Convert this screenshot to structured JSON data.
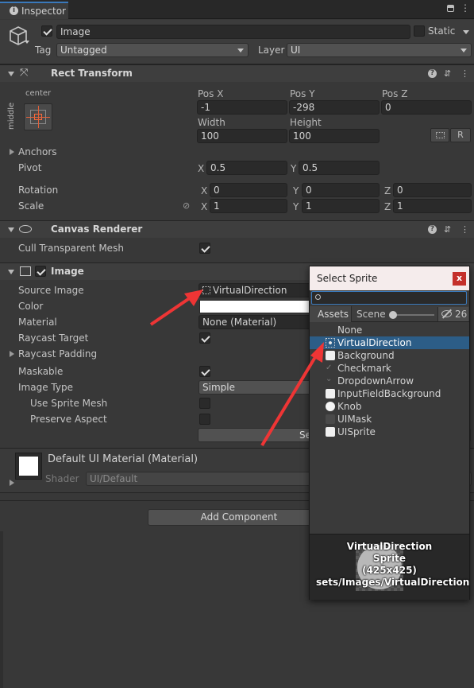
{
  "tab": {
    "title": "Inspector"
  },
  "object": {
    "name": "Image",
    "static_label": "Static",
    "tag_label": "Tag",
    "tag_value": "Untagged",
    "layer_label": "Layer",
    "layer_value": "UI"
  },
  "rect_transform": {
    "title": "Rect Transform",
    "anchor_h": "center",
    "anchor_v": "middle",
    "pos_x_label": "Pos X",
    "pos_x": "-1",
    "pos_y_label": "Pos Y",
    "pos_y": "-298",
    "pos_z_label": "Pos Z",
    "pos_z": "0",
    "width_label": "Width",
    "width": "100",
    "height_label": "Height",
    "height": "100",
    "r_button": "R",
    "anchors_label": "Anchors",
    "pivot_label": "Pivot",
    "pivot_x_label": "X",
    "pivot_x": "0.5",
    "pivot_y_label": "Y",
    "pivot_y": "0.5",
    "rotation_label": "Rotation",
    "rot_x_label": "X",
    "rot_x": "0",
    "rot_y_label": "Y",
    "rot_y": "0",
    "rot_z_label": "Z",
    "rot_z": "0",
    "scale_label": "Scale",
    "scale_x_label": "X",
    "scale_x": "1",
    "scale_y_label": "Y",
    "scale_y": "1",
    "scale_z_label": "Z",
    "scale_z": "1"
  },
  "canvas_renderer": {
    "title": "Canvas Renderer",
    "cull_label": "Cull Transparent Mesh",
    "cull_checked": true
  },
  "image_component": {
    "title": "Image",
    "source_image_label": "Source Image",
    "source_image_value": "VirtualDirection",
    "color_label": "Color",
    "material_label": "Material",
    "material_value": "None (Material)",
    "raycast_target_label": "Raycast Target",
    "raycast_padding_label": "Raycast Padding",
    "maskable_label": "Maskable",
    "image_type_label": "Image Type",
    "image_type_value": "Simple",
    "use_sprite_mesh_label": "Use Sprite Mesh",
    "preserve_aspect_label": "Preserve Aspect",
    "set_native_partial": "Se"
  },
  "material_section": {
    "title": "Default UI Material (Material)",
    "shader_label": "Shader",
    "shader_value": "UI/Default"
  },
  "add_component": "Add Component",
  "select_sprite": {
    "title": "Select Sprite",
    "close": "x",
    "search_value": "",
    "tab_assets": "Assets",
    "tab_scene": "Scene",
    "hidden_count": "26",
    "items": [
      {
        "label": "None",
        "icon": "none"
      },
      {
        "label": "VirtualDirection",
        "icon": "sprite-icon",
        "selected": true
      },
      {
        "label": "Background",
        "icon": "rounded-rect-icon"
      },
      {
        "label": "Checkmark",
        "icon": "checkmark-icon"
      },
      {
        "label": "DropdownArrow",
        "icon": "dropdown-arrow-icon"
      },
      {
        "label": "InputFieldBackground",
        "icon": "rounded-rect-icon"
      },
      {
        "label": "Knob",
        "icon": "circle-icon"
      },
      {
        "label": "UIMask",
        "icon": "dark-rect-icon"
      },
      {
        "label": "UISprite",
        "icon": "rounded-rect-icon"
      }
    ],
    "preview": {
      "name": "VirtualDirection",
      "type": "Sprite",
      "size": "(425x425)",
      "path": "sets/Images/VirtualDirection.pi"
    }
  },
  "colors": {
    "background": "#383838",
    "selection": "#2c5d87",
    "annotation_arrow": "#ee3535",
    "close_button": "#c4302b"
  }
}
